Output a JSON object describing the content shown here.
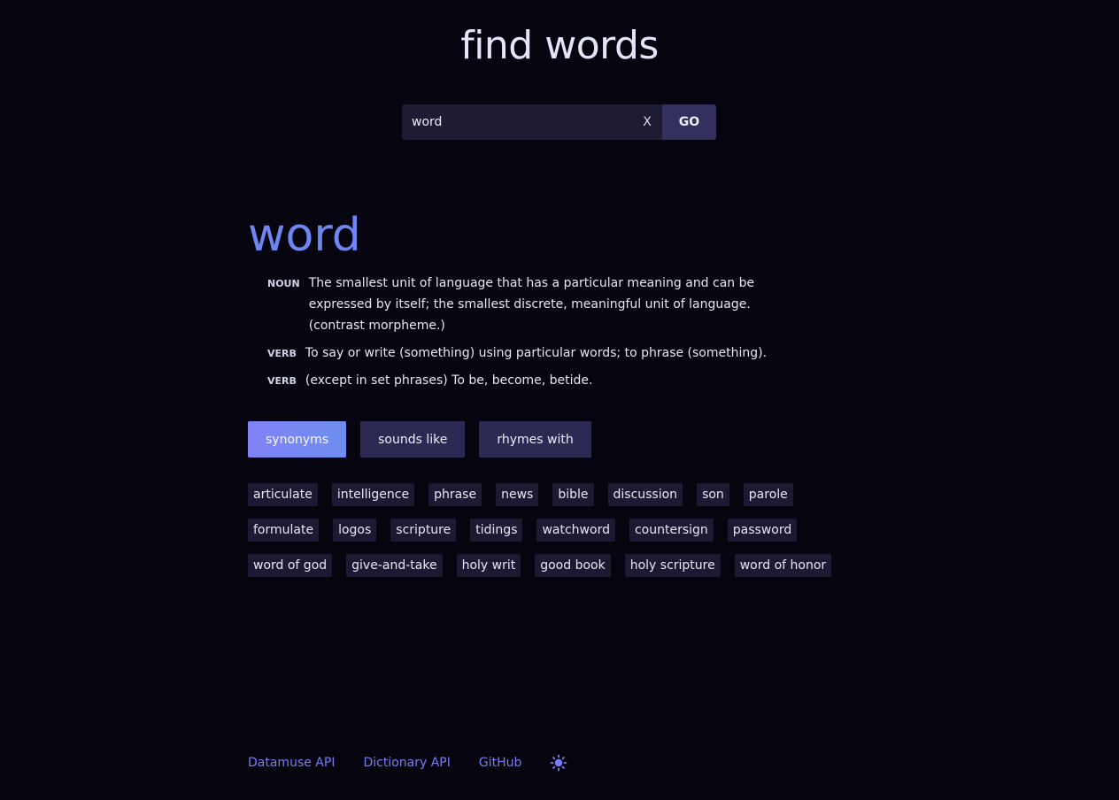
{
  "header": {
    "title": "find words"
  },
  "search": {
    "value": "word",
    "clear_label": "X",
    "go_label": "GO"
  },
  "result": {
    "word": "word",
    "definitions": [
      {
        "pos": "NOUN",
        "text": "The smallest unit of language that has a particular meaning and can be expressed by itself; the smallest discrete, meaningful unit of language. (contrast morpheme.)"
      },
      {
        "pos": "VERB",
        "text": "To say or write (something) using particular words; to phrase (something)."
      },
      {
        "pos": "VERB",
        "text": "(except in set phrases) To be, become, betide."
      }
    ]
  },
  "tabs": [
    {
      "label": "synonyms",
      "active": true
    },
    {
      "label": "sounds like",
      "active": false
    },
    {
      "label": "rhymes with",
      "active": false
    }
  ],
  "words": [
    [
      "articulate",
      "intelligence",
      "phrase",
      "news",
      "bible",
      "discussion",
      "son",
      "parole"
    ],
    [
      "formulate",
      "logos",
      "scripture",
      "tidings",
      "watchword",
      "countersign",
      "password"
    ],
    [
      "word of god",
      "give-and-take",
      "holy writ",
      "good book",
      "holy scripture",
      "word of honor"
    ]
  ],
  "footer": {
    "links": [
      "Datamuse API",
      "Dictionary API",
      "GitHub"
    ],
    "theme_icon": "sun-icon"
  },
  "colors": {
    "background": "#06050f",
    "accent": "#6e86f2",
    "link": "#7a7cf2",
    "chip": "#1c1a33",
    "tab": "#2c2a52"
  }
}
